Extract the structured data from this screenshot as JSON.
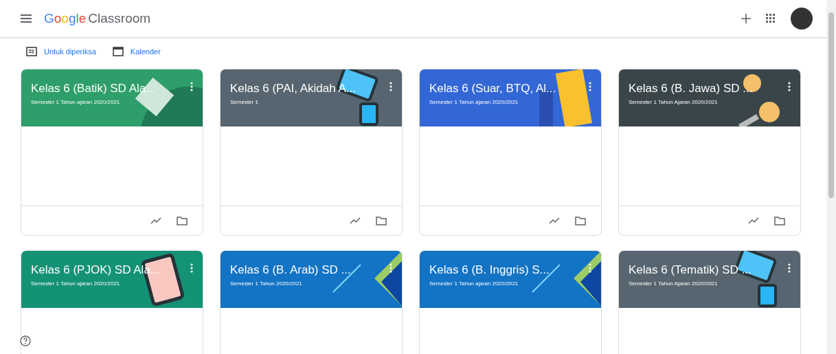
{
  "app_bar": {
    "logo_word": "Google",
    "product": "Classroom"
  },
  "subnav": [
    {
      "label": "Untuk diperiksa",
      "kind": "review"
    },
    {
      "label": "Kalender",
      "kind": "calendar"
    }
  ],
  "classes": [
    {
      "title": "Kelas 6 (Batik) SD Ala...",
      "subtitle": "Semester 1 Tahun ajaran 2020/2021",
      "color": "#2e9e6a",
      "kind": "book"
    },
    {
      "title": "Kelas 6 (PAI, Akidah A...",
      "subtitle": "Semester 1",
      "color": "#56656f",
      "kind": "tablet"
    },
    {
      "title": "Kelas 6 (Suar, BTQ, Al...",
      "subtitle": "Semester 1 Tahun ajaran 2020/2021",
      "color": "#3367d6",
      "kind": "folder"
    },
    {
      "title": "Kelas 6 (B. Jawa) SD ...",
      "subtitle": "Semester 1 Tahun Ajaran 2020/2021",
      "color": "#394549",
      "kind": "coin"
    },
    {
      "title": "Kelas 6 (PJOK) SD Ala...",
      "subtitle": "Semester 1 Tahun ajaran 2020/2021",
      "color": "#149276",
      "kind": "phone"
    },
    {
      "title": "Kelas 6 (B. Arab) SD ...",
      "subtitle": "Semester 1 Tahun 2020/2021",
      "color": "#1373c4",
      "kind": "pencil"
    },
    {
      "title": "Kelas 6 (B. Inggris) S...",
      "subtitle": "Semester 1 Tahun ajaran 2020/2021",
      "color": "#1373c4",
      "kind": "pencil"
    },
    {
      "title": "Kelas 6 (Tematik) SD ...",
      "subtitle": "Semester 1 Tahun Ajaran 2020/2021",
      "color": "#56656f",
      "kind": "tablet"
    }
  ]
}
